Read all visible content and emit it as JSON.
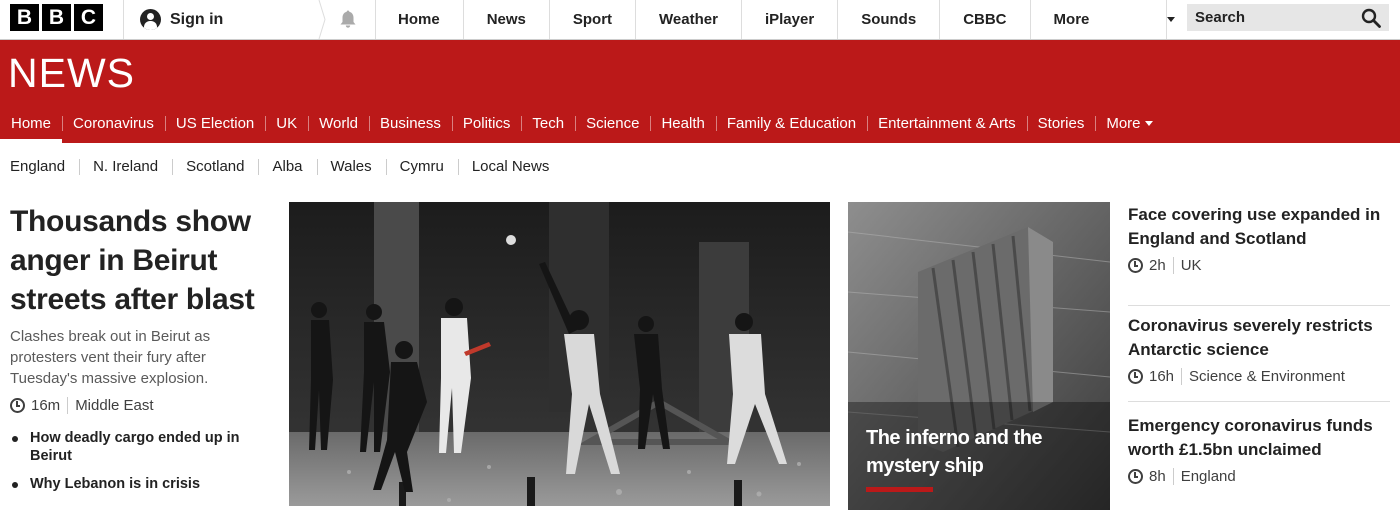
{
  "brand": {
    "logo_letters": [
      "B",
      "B",
      "C"
    ]
  },
  "account": {
    "signin_label": "Sign in"
  },
  "global_nav": {
    "items": [
      "Home",
      "News",
      "Sport",
      "Weather",
      "iPlayer",
      "Sounds",
      "CBBC"
    ],
    "more_label": "More"
  },
  "search": {
    "label": "Search"
  },
  "news_banner": {
    "title": "NEWS"
  },
  "news_nav": {
    "items": [
      "Home",
      "Coronavirus",
      "US Election",
      "UK",
      "World",
      "Business",
      "Politics",
      "Tech",
      "Science",
      "Health",
      "Family & Education",
      "Entertainment & Arts",
      "Stories"
    ],
    "active": "Home",
    "more_label": "More"
  },
  "regional_nav": {
    "items": [
      "England",
      "N. Ireland",
      "Scotland",
      "Alba",
      "Wales",
      "Cymru",
      "Local News"
    ]
  },
  "lead_story": {
    "headline": "Thousands show anger in Beirut streets after blast",
    "summary": "Clashes break out in Beirut as protesters vent their fury after Tuesday's massive explosion.",
    "time": "16m",
    "section": "Middle East",
    "related": [
      "How deadly cargo ended up in Beirut",
      "Why Lebanon is in crisis"
    ]
  },
  "feature_story": {
    "caption": "The inferno and the mystery ship"
  },
  "side_stories": [
    {
      "headline": "Face covering use expanded in England and Scotland",
      "time": "2h",
      "section": "UK"
    },
    {
      "headline": "Coronavirus severely restricts Antarctic science",
      "time": "16h",
      "section": "Science & Environment"
    },
    {
      "headline": "Emergency coronavirus funds worth £1.5bn unclaimed",
      "time": "8h",
      "section": "England"
    }
  ],
  "colors": {
    "brand_red": "#bb1919",
    "text": "#222222",
    "muted": "#5a5a5a",
    "search_bg": "#e6e6e6"
  }
}
